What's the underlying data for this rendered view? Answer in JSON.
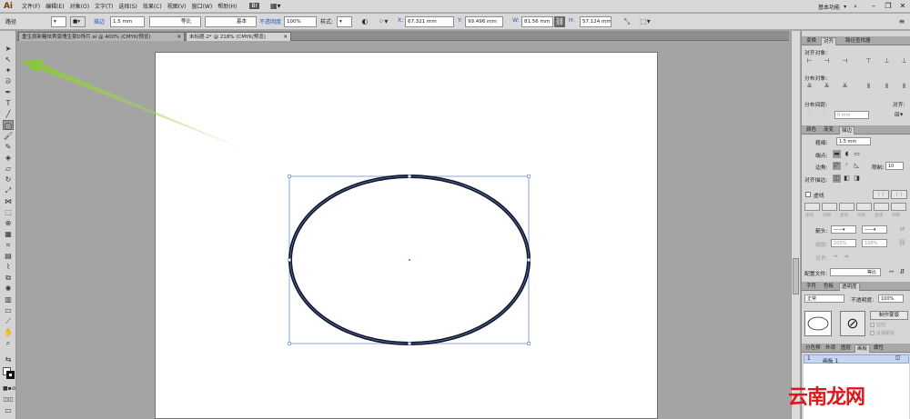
{
  "app": {
    "logo": "Ai",
    "workspace": "基本功能"
  },
  "menu": [
    "文件(F)",
    "编辑(E)",
    "对象(O)",
    "文字(T)",
    "选择(S)",
    "效果(C)",
    "视图(V)",
    "窗口(W)",
    "帮助(H)"
  ],
  "window_controls": {
    "minimize": "–",
    "restore": "❐",
    "close": "✕"
  },
  "control": {
    "object_type": "路径",
    "stroke_label": "描边",
    "stroke_weight": "1.5 mm",
    "profile": "等比",
    "brush": "基本",
    "opacity_label": "不透明度",
    "opacity": "100%",
    "style_label": "样式:",
    "x": "67.321 mm",
    "y": "99.496 mm",
    "w": "81.56 mm",
    "h": "57.124 mm"
  },
  "tabs": [
    {
      "label": "重生原新糖炫秀豪瑰生豪D饰片.ai @ 400% (CMYK/预览)"
    },
    {
      "label": "未标题-2* @ 218% (CMYK/预览)"
    }
  ],
  "panels": {
    "align": {
      "tabs": [
        "变换",
        "对齐",
        "路径查找器"
      ],
      "align_objects": "对齐对象:",
      "distribute_objects": "分布对象:",
      "distribute_spacing": "分布间距:",
      "align_to": "对齐:",
      "spacing_value": "0 mm"
    },
    "stroke": {
      "tabs": [
        "颜色",
        "渐变",
        "描边"
      ],
      "weight_label": "粗细:",
      "weight": "1.5 mm",
      "cap_label": "端点:",
      "corner_label": "边角:",
      "limit_label": "限制:",
      "limit": "10",
      "align_label": "对齐描边:",
      "dashed_label": "虚线",
      "dash_labels": [
        "虚线",
        "间隙",
        "虚线",
        "间隙",
        "虚线",
        "间隙"
      ],
      "arrow_label": "箭头:",
      "scale_label": "缩放:",
      "scale1": "100%",
      "scale2": "100%",
      "align2_label": "对齐:",
      "profile_label": "配置文件:",
      "profile": "等比"
    },
    "transparency": {
      "tabs": [
        "字符",
        "色板",
        "透明度"
      ],
      "blend": "正常",
      "opacity_label": "不透明度:",
      "opacity": "100%",
      "make_mask": "制作蒙版",
      "clip": "剪切",
      "invert": "反相蒙版"
    },
    "layers": {
      "tabs": [
        "分色预",
        "外观",
        "图层",
        "画板",
        "属性"
      ],
      "row_index": "1",
      "row_name": "画板 1"
    }
  },
  "watermark": "云南龙网",
  "colors": {
    "accent": "#2a57c5",
    "arrow": "#8cc63f",
    "selection": "#6f8fd6"
  }
}
